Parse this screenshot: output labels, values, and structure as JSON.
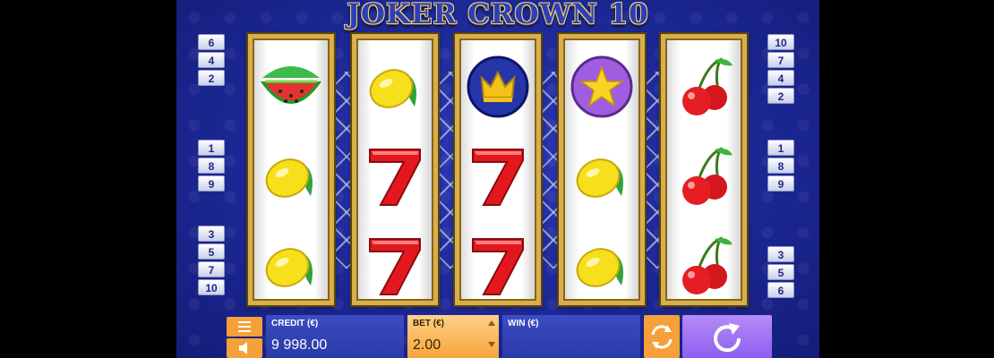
{
  "game": {
    "title": "JOKER CROWN 10",
    "bg_color": "#1c2896",
    "reel_frame_color": "#d7b04c"
  },
  "lines": {
    "left": [
      [
        "6",
        "4",
        "2"
      ],
      [
        "1",
        "8",
        "9"
      ],
      [
        "3",
        "5",
        "7",
        "10"
      ]
    ],
    "right": [
      [
        "10",
        "7",
        "4",
        "2"
      ],
      [
        "1",
        "8",
        "9"
      ],
      [
        "3",
        "5",
        "6"
      ]
    ]
  },
  "reels": [
    [
      "watermelon",
      "lemon",
      "lemon"
    ],
    [
      "lemon",
      "seven",
      "seven"
    ],
    [
      "crown",
      "seven",
      "seven"
    ],
    [
      "star",
      "lemon",
      "lemon"
    ],
    [
      "cherry",
      "cherry",
      "cherry"
    ]
  ],
  "controls": {
    "menu_icon": "menu-icon",
    "sound_icon": "speaker-icon",
    "credit_label": "CREDIT (€)",
    "credit_value": "9 998.00",
    "bet_label": "BET (€)",
    "bet_value": "2.00",
    "win_label": "WIN (€)",
    "win_value": "",
    "autoplay_icon": "autoplay-icon",
    "spin_icon": "spin-icon"
  }
}
